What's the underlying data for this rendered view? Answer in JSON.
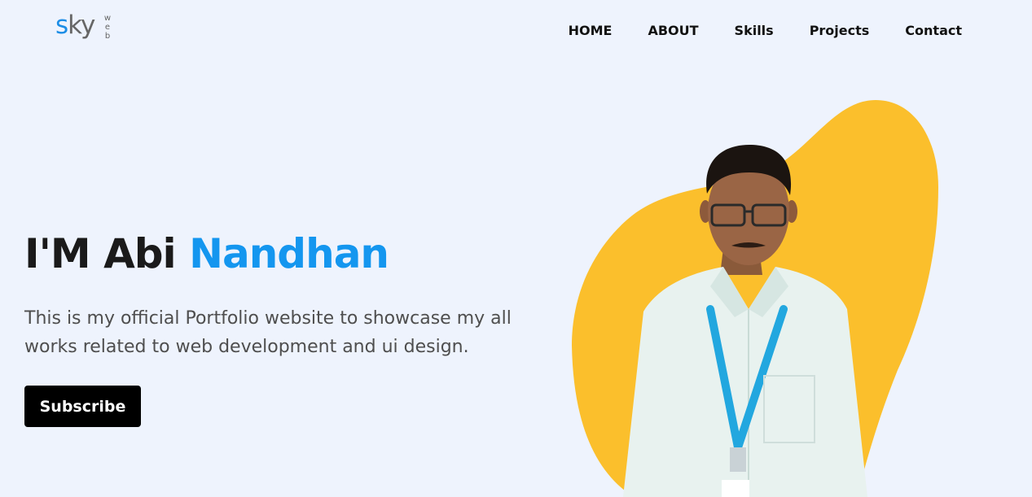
{
  "logo": {
    "s": "s",
    "ky": "ky",
    "sub": [
      "w",
      "e",
      "b"
    ]
  },
  "nav": [
    "HOME",
    "ABOUT",
    "Skills",
    "Projects",
    "Contact"
  ],
  "hero": {
    "greeting": "I'M Abi",
    "name": "Nandhan",
    "description": "This is my official Portfolio website to showcase my all works related to web development and ui design.",
    "cta": "Subscribe"
  },
  "colors": {
    "background": "#eef3fd",
    "accent": "#1496ef",
    "blob": "#fbbf2c",
    "button": "#000000"
  }
}
